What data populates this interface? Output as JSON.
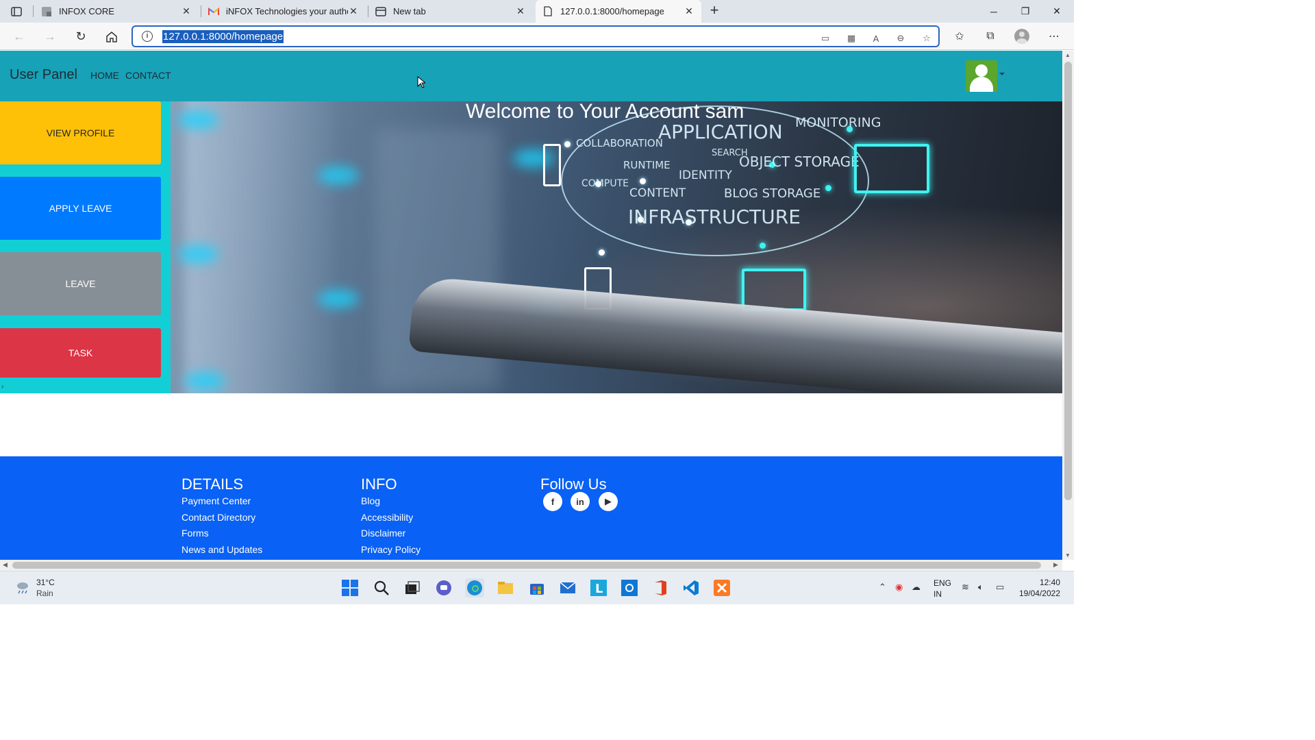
{
  "browser": {
    "tabs": [
      {
        "title": "INFOX CORE",
        "icon": "page-icon"
      },
      {
        "title": "iNFOX Technologies your authen",
        "icon": "gmail-icon"
      },
      {
        "title": "New tab",
        "icon": "newtab-icon"
      },
      {
        "title": "127.0.0.1:8000/homepage",
        "icon": "document-icon",
        "active": true
      }
    ],
    "url": "127.0.0.1:8000/homepage"
  },
  "navbar": {
    "brand": "User Panel",
    "links": [
      "HOME",
      "CONTACT"
    ]
  },
  "sidebar": {
    "buttons": [
      {
        "label": "VIEW PROFILE",
        "bg": "#ffc107",
        "color": "#212529"
      },
      {
        "label": "APPLY LEAVE",
        "bg": "#007bff",
        "color": "#ffffff"
      },
      {
        "label": "LEAVE",
        "bg": "#868e96",
        "color": "#ffffff"
      },
      {
        "label": "TASK",
        "bg": "#dc3545",
        "color": "#ffffff"
      }
    ]
  },
  "hero": {
    "welcome": "Welcome to Your Account sam",
    "tags": [
      "COLLABORATION",
      "APPLICATION",
      "MONITORING",
      "RUNTIME",
      "SEARCH",
      "OBJECT STORAGE",
      "COMPUTE",
      "IDENTITY",
      "CONTENT",
      "BLOG STORAGE",
      "INFRASTRUCTURE"
    ]
  },
  "footer": {
    "columns": [
      {
        "heading": "DETAILS",
        "links": [
          "Payment Center",
          "Contact Directory",
          "Forms",
          "News and Updates"
        ]
      },
      {
        "heading": "INFO",
        "links": [
          "Blog",
          "Accessibility",
          "Disclaimer",
          "Privacy Policy"
        ]
      },
      {
        "heading": "Follow Us",
        "links": []
      }
    ],
    "social": [
      "facebook-icon",
      "linkedin-icon",
      "youtube-icon"
    ],
    "bg": "#0961f5"
  },
  "taskbar": {
    "weather": {
      "temp": "31°C",
      "desc": "Rain"
    },
    "lang": [
      "ENG",
      "IN"
    ],
    "time": "12:40",
    "date": "19/04/2022"
  },
  "colors": {
    "navbar": "#17a2b8",
    "sidebar": "#12cfd6"
  }
}
